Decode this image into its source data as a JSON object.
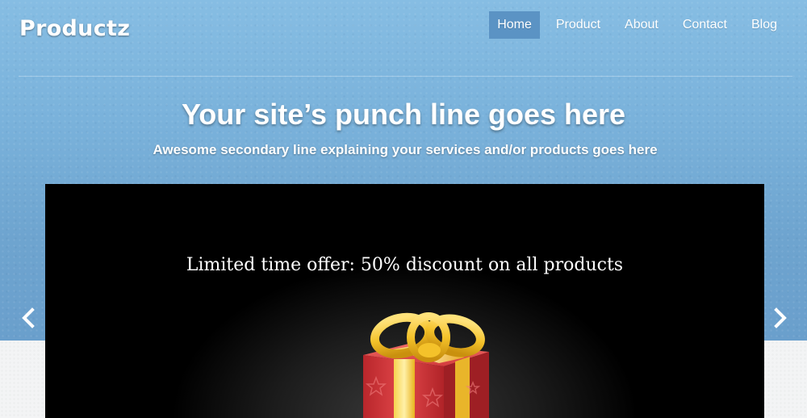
{
  "header": {
    "logo": "Productz",
    "nav": [
      {
        "label": "Home",
        "active": true
      },
      {
        "label": "Product",
        "active": false
      },
      {
        "label": "About",
        "active": false
      },
      {
        "label": "Contact",
        "active": false
      },
      {
        "label": "Blog",
        "active": false
      }
    ]
  },
  "hero": {
    "headline": "Your site’s punch line goes here",
    "subline": "Awesome secondary line explaining your services and/or products goes here"
  },
  "slider": {
    "caption": "Limited time offer: 50% discount on all products",
    "image_icon": "gift-box-icon",
    "prev_icon": "chevron-left-icon",
    "next_icon": "chevron-right-icon"
  },
  "colors": {
    "sky": "#7ab2db",
    "nav_active": "#5b93c4",
    "slide_bg": "#000000",
    "ribbon": "#f0c52a",
    "box": "#d93a3a"
  }
}
